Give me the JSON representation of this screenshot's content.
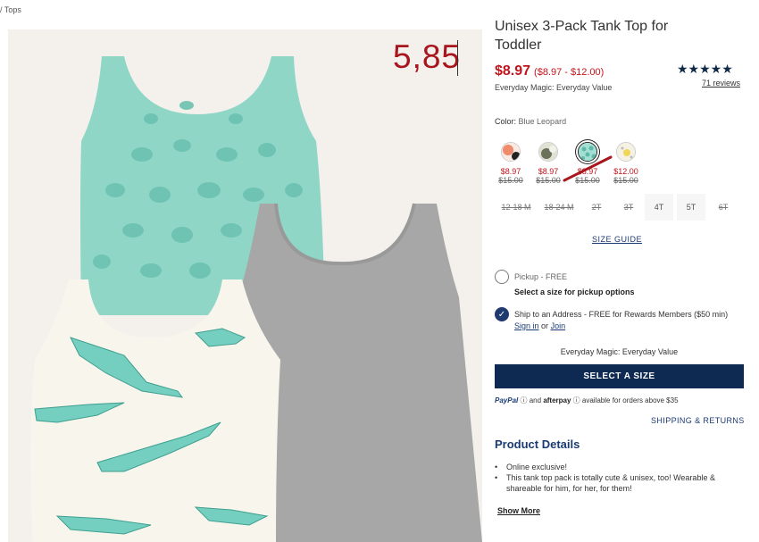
{
  "breadcrumb": "/ Tops",
  "overlay_value": "5,85",
  "product": {
    "title": "Unisex 3-Pack Tank Top for Toddler",
    "price": "$8.97",
    "price_range": "($8.97 - $12.00)",
    "everyday_magic": "Everyday Magic: Everyday Value",
    "stars": "★★★★★",
    "reviews": "71 reviews",
    "rating": 5
  },
  "color": {
    "label": "Color:",
    "value": "Blue Leopard",
    "swatches": [
      {
        "name": "coral-pattern",
        "price": "$8.97",
        "old_price": "$15.00"
      },
      {
        "name": "sage-pattern",
        "price": "$8.97",
        "old_price": "$15.00"
      },
      {
        "name": "blue-leopard",
        "price": "$8.97",
        "old_price": "$15.00"
      },
      {
        "name": "cream-pattern",
        "price": "$12.00",
        "old_price": "$15.00"
      }
    ]
  },
  "sizes": [
    {
      "label": "12-18 M",
      "available": false
    },
    {
      "label": "18-24 M",
      "available": false
    },
    {
      "label": "2T",
      "available": false
    },
    {
      "label": "3T",
      "available": false
    },
    {
      "label": "4T",
      "available": true
    },
    {
      "label": "5T",
      "available": true
    },
    {
      "label": "6T",
      "available": false
    }
  ],
  "size_guide": "SIZE GUIDE",
  "pickup": {
    "title": "Pickup - FREE",
    "note": "Select a size for pickup options"
  },
  "ship": {
    "text": "Ship to an Address - FREE for Rewards Members ($50 min)",
    "sign_in": "Sign in",
    "or": "or",
    "join": "Join"
  },
  "everyday_magic_2": "Everyday Magic: Everyday Value",
  "cta": "SELECT A SIZE",
  "payment": {
    "paypal": "PayPal",
    "and": "and",
    "afterpay": "afterpay",
    "note": "available for orders above $35"
  },
  "shipping_returns": "SHIPPING & RETURNS",
  "details": {
    "title": "Product Details",
    "items": [
      "Online exclusive!",
      "This tank top pack is totally cute & unisex, too! Wearable & shareable for him, for her, for them!"
    ],
    "show_more": "Show More"
  },
  "colors": {
    "accent": "#0f2a52",
    "sale": "#c2141c",
    "link": "#1a3a73"
  }
}
